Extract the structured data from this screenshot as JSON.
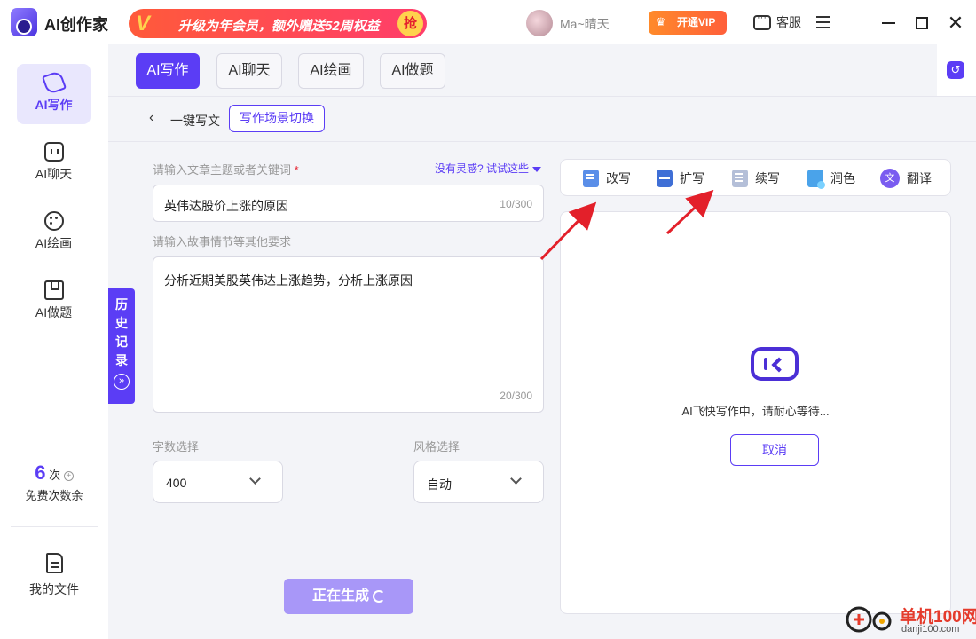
{
  "app": {
    "name": "AI创作家"
  },
  "promo": {
    "text": "升级为年会员，额外赠送52周权益",
    "badge": "抢"
  },
  "user": {
    "name": "Ma~晴天"
  },
  "header": {
    "vip_label": "开通VIP",
    "service_label": "客服"
  },
  "sidebar": {
    "items": [
      {
        "label": "AI写作",
        "icon": "pen-icon",
        "active": true
      },
      {
        "label": "AI聊天",
        "icon": "chat-bot-icon",
        "active": false
      },
      {
        "label": "AI绘画",
        "icon": "palette-icon",
        "active": false
      },
      {
        "label": "AI做题",
        "icon": "book-icon",
        "active": false
      }
    ],
    "credits": {
      "count": "6",
      "unit": "次",
      "label": "免费次数余"
    },
    "files_label": "我的文件"
  },
  "tabs": [
    {
      "label": "AI写作",
      "active": true
    },
    {
      "label": "AI聊天",
      "active": false
    },
    {
      "label": "AI绘画",
      "active": false
    },
    {
      "label": "AI做题",
      "active": false
    }
  ],
  "subbar": {
    "title": "一键写文",
    "scene_switch": "写作场景切换"
  },
  "form": {
    "topic_label": "请输入文章主题或者关键词",
    "required_mark": "*",
    "inspire_link": "没有灵感? 试试这些",
    "topic_value": "英伟达股价上涨的原因",
    "topic_count": "10/300",
    "detail_label": "请输入故事情节等其他要求",
    "detail_value": "分析近期美股英伟达上涨趋势，分析上涨原因",
    "detail_count": "20/300",
    "word_count_label": "字数选择",
    "word_count_value": "400",
    "style_label": "风格选择",
    "style_value": "自动",
    "generate_button": "正在生成"
  },
  "history_tab": {
    "chars": [
      "历",
      "史",
      "记",
      "录"
    ]
  },
  "tools": [
    {
      "label": "改写",
      "icon": "rewrite-icon"
    },
    {
      "label": "扩写",
      "icon": "expand-icon"
    },
    {
      "label": "续写",
      "icon": "continue-icon"
    },
    {
      "label": "润色",
      "icon": "polish-icon"
    },
    {
      "label": "翻译",
      "icon": "translate-icon"
    }
  ],
  "output": {
    "loading_text": "AI飞快写作中，请耐心等待...",
    "cancel_button": "取消"
  },
  "watermark": {
    "cn": "单机100网",
    "url": "danji100.com"
  },
  "colors": {
    "accent": "#5b3df5",
    "annotation_arrow": "#e3202a"
  }
}
